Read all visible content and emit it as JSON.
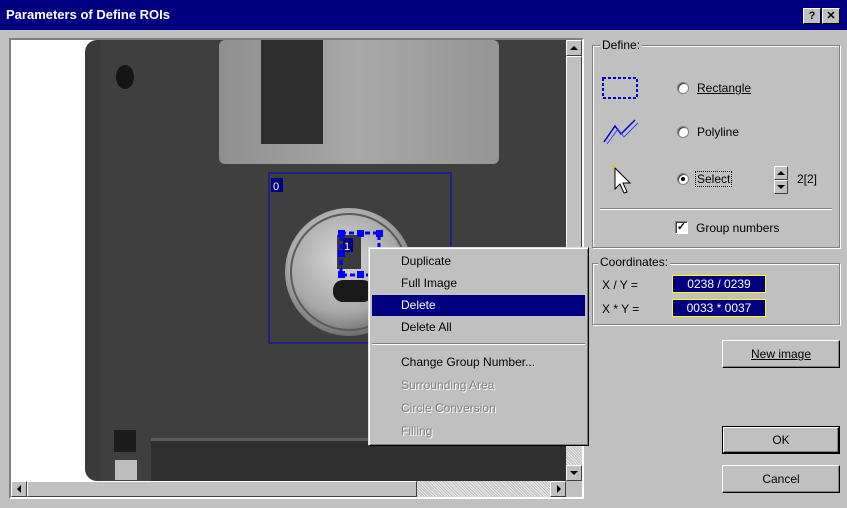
{
  "window": {
    "title": "Parameters of Define ROIs",
    "help_label": "?",
    "close_label": "✕"
  },
  "image": {
    "roi_labels": [
      "0",
      "1"
    ]
  },
  "define": {
    "legend": "Define:",
    "options": [
      {
        "label": "Rectangle",
        "checked": false,
        "icon": "rectangle-tool-icon"
      },
      {
        "label": "Polyline",
        "checked": false,
        "icon": "polyline-tool-icon"
      },
      {
        "label": "Select",
        "checked": true,
        "icon": "pointer-arrow-icon"
      }
    ],
    "select_count": "2[2]",
    "group_numbers_label": "Group numbers",
    "group_numbers_checked": true
  },
  "coordinates": {
    "legend": "Coordinates:",
    "xy_label": "X / Y =",
    "xy_value": "0238 / 0239",
    "wh_label": "X * Y =",
    "wh_value": "0033 * 0037"
  },
  "buttons": {
    "new_image": "New image",
    "ok": "OK",
    "cancel": "Cancel"
  },
  "context_menu": {
    "items": [
      {
        "label": "Duplicate",
        "enabled": true,
        "selected": false
      },
      {
        "label": "Full Image",
        "enabled": true,
        "selected": false
      },
      {
        "label": "Delete",
        "enabled": true,
        "selected": true
      },
      {
        "label": "Delete All",
        "enabled": true,
        "selected": false
      },
      {
        "label": "Change Group Number...",
        "enabled": true,
        "selected": false
      },
      {
        "label": "Surrounding Area",
        "enabled": false,
        "selected": false
      },
      {
        "label": "Circle Conversion",
        "enabled": false,
        "selected": false
      },
      {
        "label": "Filling",
        "enabled": false,
        "selected": false
      }
    ]
  },
  "colors": {
    "title_bar": "#000080",
    "roi_outline": "#0000cc",
    "selection_highlight": "#000080",
    "coord_border": "#ffff00"
  }
}
